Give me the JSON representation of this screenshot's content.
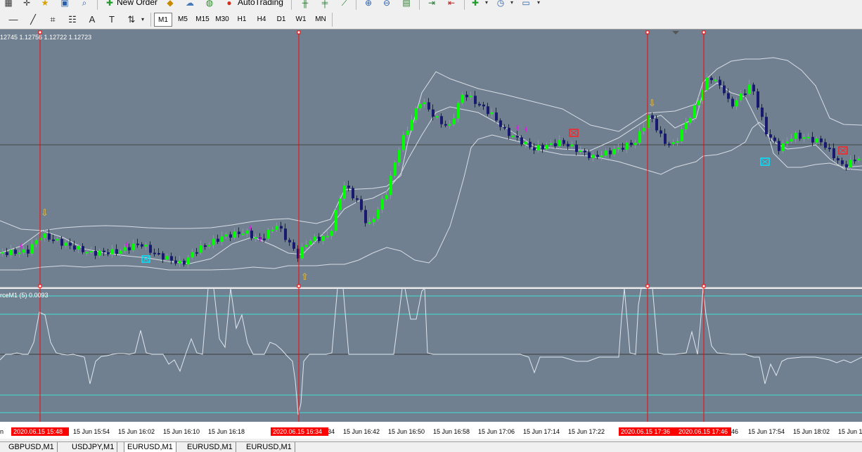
{
  "toolbar": {
    "new_order_label": "New Order",
    "autotrading_label": "AutoTrading",
    "timeframes": [
      "M1",
      "M5",
      "M15",
      "M30",
      "H1",
      "H4",
      "D1",
      "W1",
      "MN"
    ],
    "active_timeframe": "M1"
  },
  "chart": {
    "price_info": "12745 1.12756 1.12722 1.12723",
    "indicator_label": "rceM1 (5) 0.0093",
    "background_color": "#708090",
    "bull_color": "#00ff00",
    "bear_color": "#191970",
    "band_color": "#d8dce4",
    "vline_color": "#ff0000",
    "time_labels": [
      "n",
      "15 Jun 15:54",
      "15 Jun 16:02",
      "15 Jun 16:10",
      "15 Jun 16:18",
      "34",
      "15 Jun 16:42",
      "15 Jun 16:50",
      "15 Jun 16:58",
      "15 Jun 17:06",
      "15 Jun 17:14",
      "15 Jun 17:22",
      "46",
      "15 Jun 17:54",
      "15 Jun 18:02",
      "15 Jun 1"
    ],
    "highlight_labels": [
      "2020.06.15 15:48",
      "2020.06.15 16:34",
      "2020.06.15 17:36",
      "2020.06.15 17:46"
    ]
  },
  "tabs": [
    {
      "label": "GBPUSD,M1",
      "active": false
    },
    {
      "label": "USDJPY,M1",
      "active": false
    },
    {
      "label": "EURUSD,M1",
      "active": true
    },
    {
      "label": "EURUSD,M1",
      "active": false
    },
    {
      "label": "EURUSD,M1",
      "active": false
    }
  ]
}
